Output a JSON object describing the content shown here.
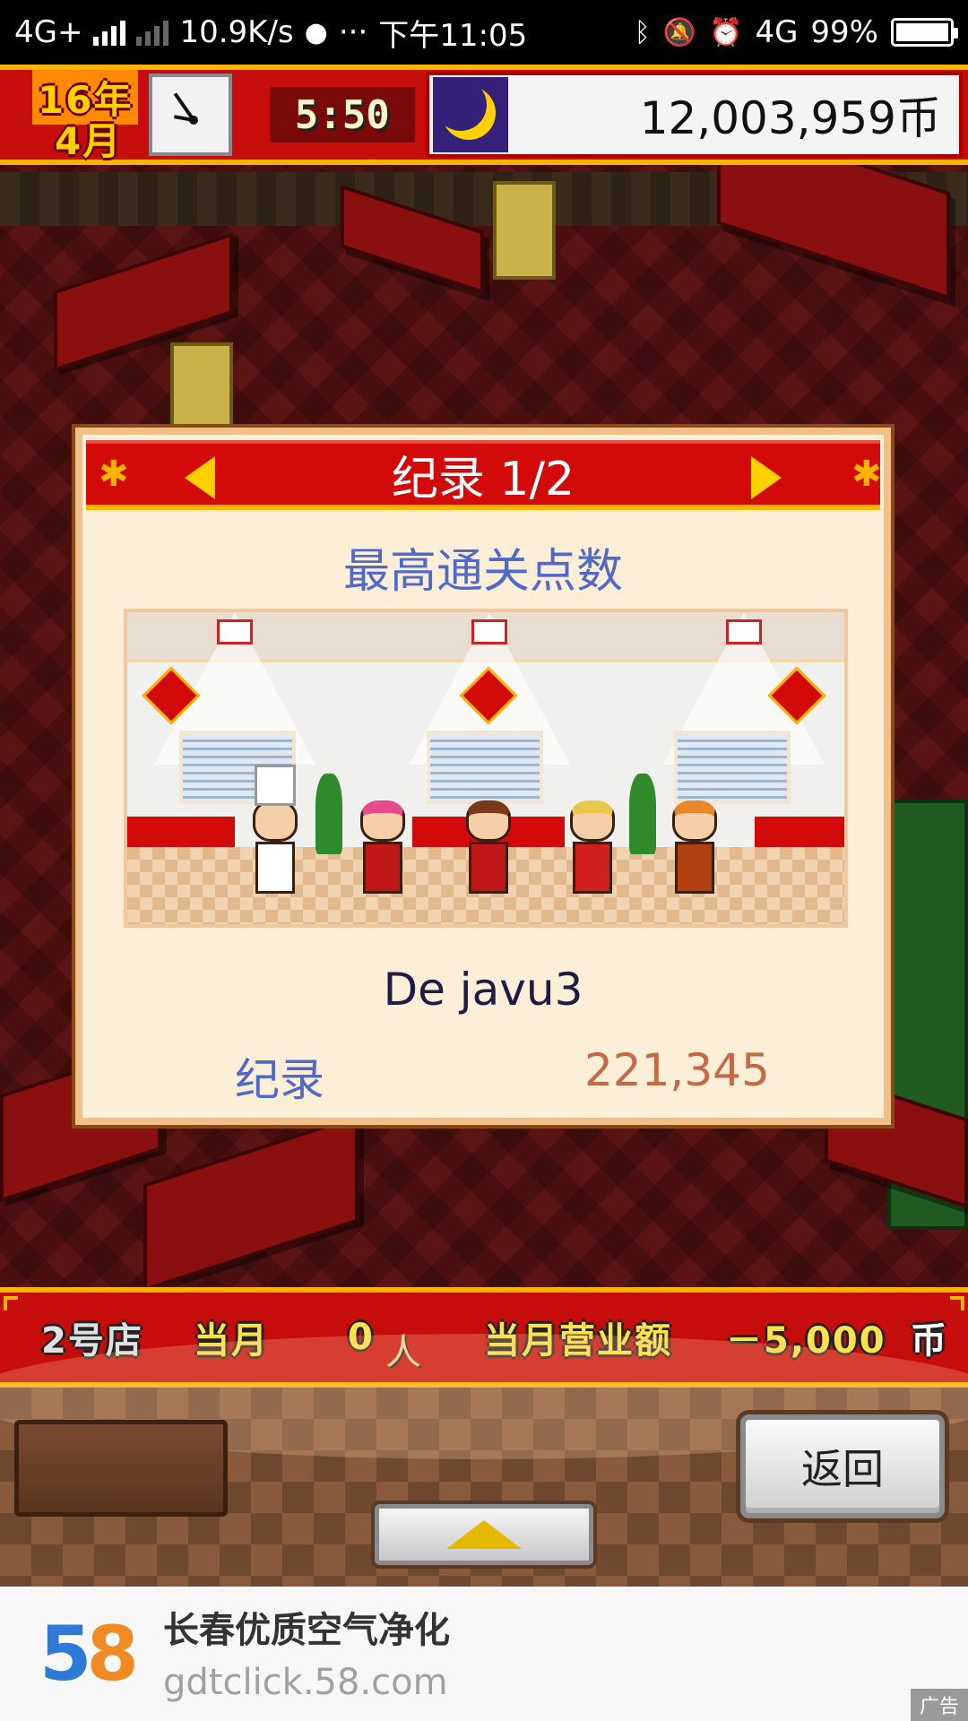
{
  "status_bar": {
    "network": "4G+",
    "speed": "10.9K/s",
    "more": "···",
    "time": "下午11:05",
    "network2": "4G",
    "battery": "99%"
  },
  "hud": {
    "year": "16",
    "year_unit": "年",
    "month": "4",
    "month_unit": "月",
    "time": "5:50",
    "money": "12,003,959币",
    "time_of_day_icon": "moon-icon"
  },
  "dialog": {
    "title": "纪录 1/2",
    "subtitle": "最高通关点数",
    "player_name": "De javu3",
    "record_label": "纪录",
    "record_value": "221,345"
  },
  "shop_bar": {
    "shop_no": "2号店",
    "current_month": "当月",
    "customers": "0",
    "month_sales_label": "当月营业额",
    "month_sales_value": "－5,000",
    "coin": "币"
  },
  "controls": {
    "back_label": "返回"
  },
  "ad": {
    "logo_five": "5",
    "logo_eight": "8",
    "title": "长春优质空气净化",
    "url": "gdtclick.58.com",
    "tag": "广告"
  }
}
